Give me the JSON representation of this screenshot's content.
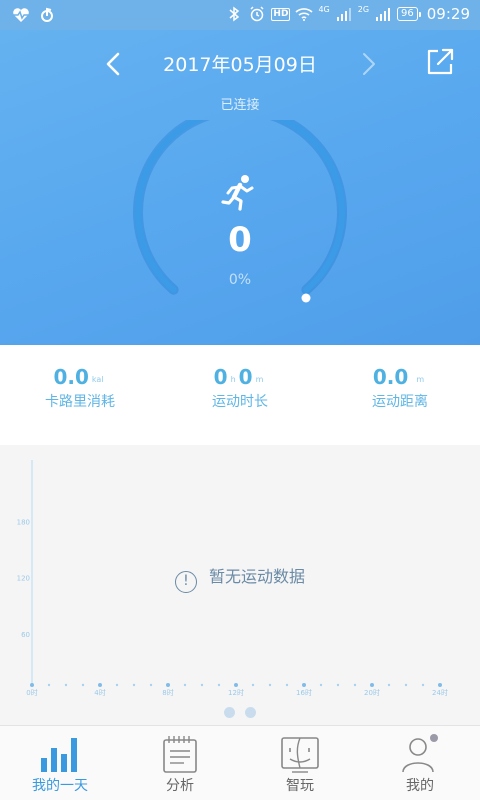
{
  "status_bar": {
    "network_left": "4G",
    "network_right": "2G",
    "hd": "HD",
    "battery": "96",
    "time": "09:29"
  },
  "header": {
    "date": "2017年05月09日",
    "connection_status": "已连接"
  },
  "progress": {
    "steps": "0",
    "percent": "0%",
    "fraction": 0
  },
  "stats": [
    {
      "value": "0.0",
      "unit": "kal",
      "label": "卡路里消耗"
    },
    {
      "value_h": "0",
      "unit_h": "h",
      "value_m": "0",
      "unit_m": "m",
      "label": "运动时长"
    },
    {
      "value": "0.0",
      "unit": "m",
      "label": "运动距离"
    }
  ],
  "chart_data": {
    "type": "bar",
    "title": "",
    "xlabel": "",
    "ylabel": "",
    "y_ticks": [
      "180",
      "120",
      "60"
    ],
    "x_ticks": [
      "0时",
      "4时",
      "8时",
      "12时",
      "16时",
      "20时",
      "24时"
    ],
    "ylim": [
      0,
      240
    ],
    "values": [],
    "empty_message": "暂无运动数据"
  },
  "pager": {
    "pages": 2,
    "current": 0
  },
  "nav": {
    "tabs": [
      {
        "label": "我的一天",
        "icon": "bar-chart-icon",
        "active": true
      },
      {
        "label": "分析",
        "icon": "notepad-icon",
        "active": false
      },
      {
        "label": "智玩",
        "icon": "finder-face-icon",
        "active": false
      },
      {
        "label": "我的",
        "icon": "user-profile-icon",
        "active": false
      }
    ]
  },
  "colors": {
    "hero_gradient_start": "#65b2f0",
    "hero_gradient_end": "#4f9de9",
    "accent": "#3a9ae0",
    "stat_value": "#4fb0e2"
  }
}
